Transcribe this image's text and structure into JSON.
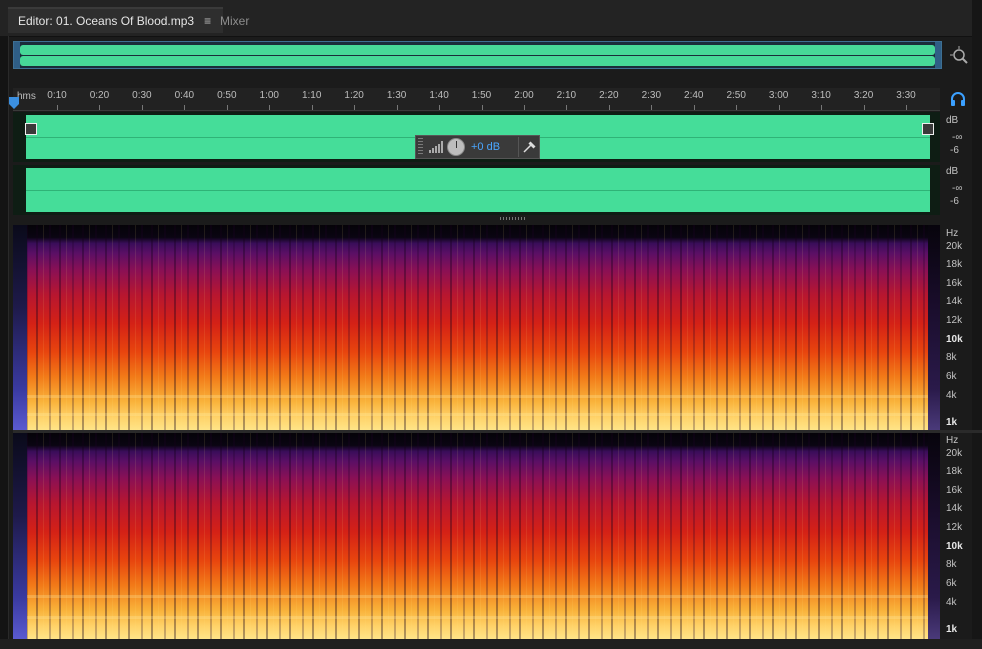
{
  "tabs": {
    "editor_label": "Editor: 01. Oceans Of Blood.mp3",
    "menu_glyph": "≡",
    "mixer_label": "Mixer"
  },
  "ruler": {
    "unit": "hms",
    "ticks": [
      "0:10",
      "0:20",
      "0:30",
      "0:40",
      "0:50",
      "1:00",
      "1:10",
      "1:20",
      "1:30",
      "1:40",
      "1:50",
      "2:00",
      "2:10",
      "2:20",
      "2:30",
      "2:40",
      "2:50",
      "3:00",
      "3:10",
      "3:20",
      "3:30"
    ]
  },
  "waveform": {
    "channels": [
      {
        "scale": [
          "dB",
          "-∞",
          "-6"
        ]
      },
      {
        "scale": [
          "dB",
          "-∞",
          "-6"
        ]
      }
    ],
    "color": "#45dd99"
  },
  "hud": {
    "value": "+0 dB"
  },
  "spectral": {
    "unit": "Hz",
    "labels": [
      "20k",
      "18k",
      "16k",
      "14k",
      "12k",
      "10k",
      "8k",
      "6k",
      "4k",
      "1k"
    ]
  },
  "colors": {
    "accent_blue": "#4aa6ff",
    "waveform_green": "#45dd99",
    "selection_border": "#3d6f93"
  },
  "icons": [
    "zoom-icon",
    "headphones-icon",
    "playhead-icon",
    "pin-icon",
    "meter-icon"
  ]
}
